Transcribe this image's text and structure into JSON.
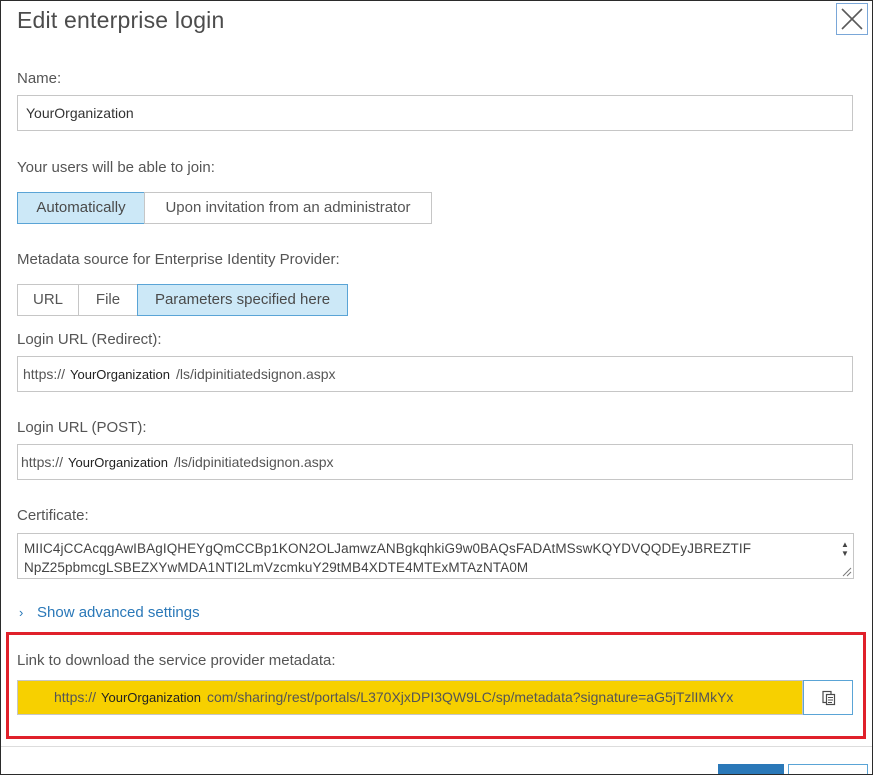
{
  "dialog": {
    "title": "Edit enterprise login"
  },
  "name": {
    "label": "Name:",
    "value": "YourOrganization"
  },
  "join": {
    "label": "Your users will be able to join:",
    "options": [
      {
        "label": "Automatically",
        "selected": true
      },
      {
        "label": "Upon invitation from an administrator",
        "selected": false
      }
    ]
  },
  "metadata_source": {
    "label": "Metadata source for Enterprise Identity Provider:",
    "options": [
      {
        "label": "URL",
        "selected": false
      },
      {
        "label": "File",
        "selected": false
      },
      {
        "label": "Parameters specified here",
        "selected": true
      }
    ]
  },
  "login_redirect": {
    "label": "Login URL (Redirect):",
    "prefix": "https://",
    "org": "YourOrganization",
    "suffix": "/ls/idpinitiatedsignon.aspx"
  },
  "login_post": {
    "label": "Login URL (POST):",
    "prefix": "https://",
    "org": "YourOrganization",
    "suffix": "/ls/idpinitiatedsignon.aspx"
  },
  "certificate": {
    "label": "Certificate:",
    "line1": "MIIC4jCCAcqgAwIBAgIQHEYgQmCCBp1KON2OLJamwzANBgkqhkiG9w0BAQsFADAtMSswKQYDVQQDEyJBREZTIF",
    "line2": "NpZ25pbmcgLSBEZXYwMDA1NTI2LmVzcmkuY29tMB4XDTE4MTExMTAzNTA0M"
  },
  "advanced": {
    "label": "Show advanced settings"
  },
  "sp_metadata": {
    "label": "Link to download the service provider metadata:",
    "prefix": "https://",
    "org": "YourOrganization",
    "suffix": "com/sharing/rest/portals/L370XjxDPI3QW9LC/sp/metadata?signature=aG5jTzlIMkYx"
  },
  "colors": {
    "accent": "#2a78b8",
    "selected_bg": "#cce8f7",
    "highlight": "#f7d000",
    "annotation_border": "#e0202a"
  }
}
